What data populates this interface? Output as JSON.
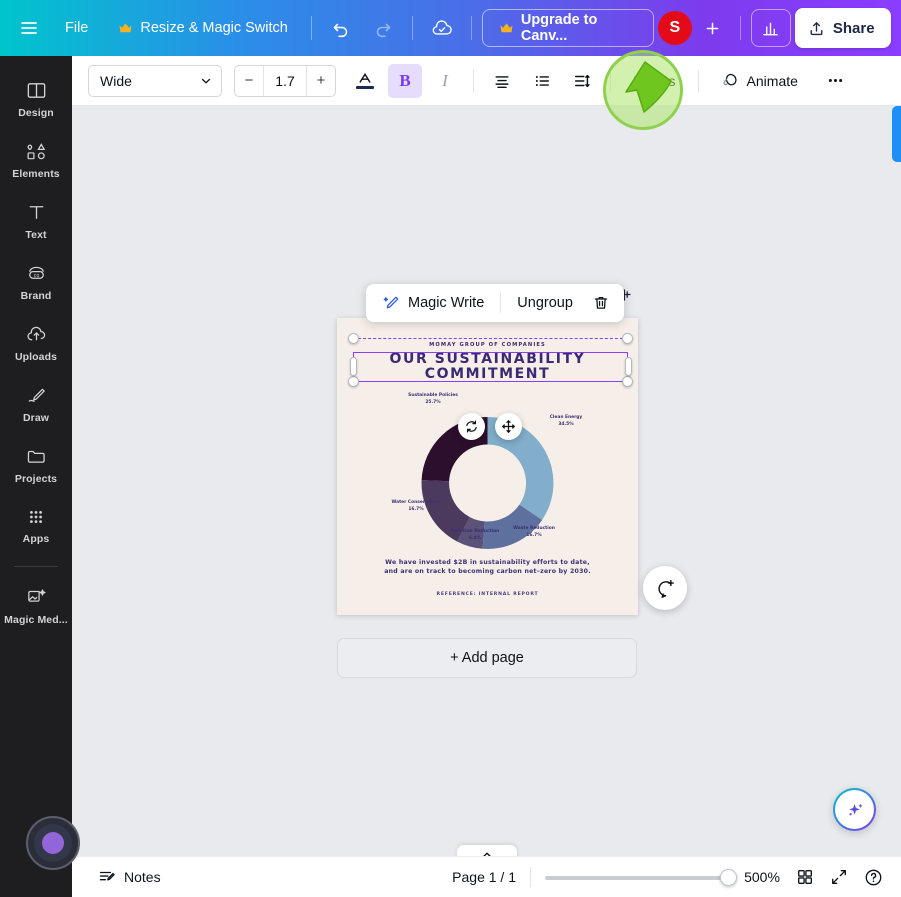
{
  "header": {
    "menu_icon": "hamburger-menu-icon",
    "file_label": "File",
    "resize_label": "Resize & Magic Switch",
    "resize_icon": "crown-icon",
    "undo_icon": "undo-arrow-icon",
    "redo_icon": "redo-arrow-icon",
    "saved_icon": "cloud-check-icon",
    "upgrade_label": "Upgrade to Canv...",
    "upgrade_icon": "crown-icon",
    "avatar_initial": "S",
    "add_member_icon": "plus-icon",
    "insights_icon": "bar-chart-icon",
    "share_label": "Share",
    "share_icon": "upload-arrow-icon"
  },
  "sidebar": {
    "items": [
      {
        "label": "Design",
        "icon": "layout-panels-icon"
      },
      {
        "label": "Elements",
        "icon": "shapes-icon"
      },
      {
        "label": "Text",
        "icon": "text-t-icon"
      },
      {
        "label": "Brand",
        "icon": "brand-badge-icon"
      },
      {
        "label": "Uploads",
        "icon": "upload-cloud-icon"
      },
      {
        "label": "Draw",
        "icon": "pencil-draw-icon"
      },
      {
        "label": "Projects",
        "icon": "folder-icon"
      },
      {
        "label": "Apps",
        "icon": "grid-dots-icon"
      },
      {
        "label": "Magic Med...",
        "icon": "magic-media-icon"
      }
    ],
    "recorder_icon": "record-indicator-icon"
  },
  "toolbar": {
    "font_value": "Wide",
    "font_chevron_icon": "chevron-down-icon",
    "size_decrement": "−",
    "size_value": "1.7",
    "size_increment": "+",
    "text_color_icon": "text-color-a-icon",
    "bold_label": "B",
    "italic_label": "I",
    "align_icon": "text-align-icon",
    "list_icon": "bullet-list-icon",
    "spacing_icon": "line-spacing-icon",
    "effects_label": "Effects",
    "animate_label": "Animate",
    "animate_icon": "animate-circle-icon",
    "more_icon": "more-dots-icon"
  },
  "element_toolbar": {
    "magic_write_label": "Magic Write",
    "magic_write_icon": "magic-pen-icon",
    "ungroup_label": "Ungroup",
    "delete_icon": "trash-icon",
    "duplicate_icon": "duplicate-page-icon"
  },
  "canvas": {
    "add_page_label": "+ Add page",
    "rotate_icon": "rotate-handle-icon",
    "move_icon": "move-crosshair-icon",
    "comment_icon": "add-comment-icon",
    "magic_icon": "magic-sparkle-icon",
    "page_nav_icon": "chevron-up-icon"
  },
  "design": {
    "eyebrow": "MOMAY GROUP OF COMPANIES",
    "title_line1": "OUR SUSTAINABILITY",
    "title_line2": "COMMITMENT",
    "claim": "We have invested $2B in sustainability efforts to date,\nand are on track to becoming carbon net–zero by 2030.",
    "reference": "REFERENCE: INTERNAL REPORT",
    "page_bg": "#f6efe9",
    "accent": "#3a2a72"
  },
  "chart_data": {
    "type": "pie",
    "title": "Our Sustainability Commitment",
    "donut": true,
    "categories": [
      "Clean Energy",
      "Waste Reduction",
      "Pollution Reduction",
      "Water Conservation",
      "Sustainable Policies"
    ],
    "values": [
      34.5,
      16.7,
      6.4,
      16.7,
      25.7
    ],
    "labels": [
      {
        "name": "Clean Energy",
        "value": "34.5%"
      },
      {
        "name": "Waste Reduction",
        "value": "16.7%"
      },
      {
        "name": "Pollution Reduction",
        "value": "6.4%"
      },
      {
        "name": "Water Conservation",
        "value": "16.7%"
      },
      {
        "name": "Sustainable Policies",
        "value": "25.7%"
      }
    ],
    "colors": [
      "#82aecb",
      "#5e709e",
      "#5b5279",
      "#4c3a5e",
      "#2b0f2c"
    ],
    "legend": "labels-around-chart"
  },
  "bottombar": {
    "notes_label": "Notes",
    "notes_icon": "notes-lines-icon",
    "page_count": "Page 1 / 1",
    "zoom_value": "500%",
    "grid_icon": "grid-view-icon",
    "fullscreen_icon": "expand-arrows-icon",
    "help_icon": "question-circle-icon"
  }
}
